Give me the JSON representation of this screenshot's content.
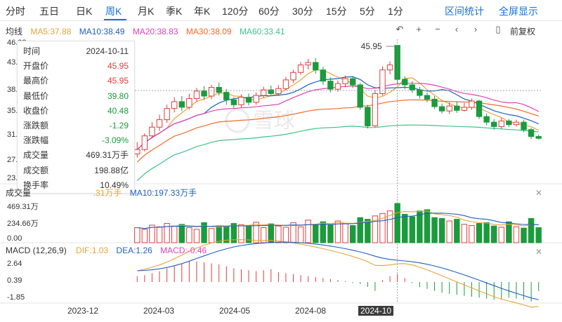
{
  "tabs": [
    {
      "label": "分时",
      "active": false
    },
    {
      "label": "五日",
      "active": false
    },
    {
      "label": "日K",
      "active": false
    },
    {
      "label": "周K",
      "active": true
    },
    {
      "label": "月K",
      "active": false
    },
    {
      "label": "季K",
      "active": false
    },
    {
      "label": "年K",
      "active": false
    },
    {
      "label": "120分",
      "active": false
    },
    {
      "label": "60分",
      "active": false
    },
    {
      "label": "30分",
      "active": false
    },
    {
      "label": "15分",
      "active": false
    },
    {
      "label": "5分",
      "active": false
    },
    {
      "label": "1分",
      "active": false
    }
  ],
  "top_right": {
    "interval_stats": "区间统计",
    "fullscreen": "全屏显示"
  },
  "ma_bar": {
    "label": "均线",
    "ma5": "MA5:37.88",
    "ma10": "MA10:38.49",
    "ma20": "MA20:38.83",
    "ma30": "MA30:38.09",
    "ma60": "MA60:33.41"
  },
  "controls": {
    "rewind_icon": "↶",
    "zoom_in": "+",
    "zoom_out": "−",
    "prev": "‹",
    "next": "›",
    "toggle": "▯",
    "adjust": "前复权"
  },
  "price_axis": [
    "46.93",
    "43.06",
    "38.71",
    "35.31",
    "31.44",
    "27.56",
    "23.69"
  ],
  "peak_label": "45.95",
  "crosshair_price": "38.71",
  "watermark": "雪球",
  "tooltip": {
    "rows": [
      {
        "k": "时间",
        "v": "2024-10-11",
        "color": "#333333"
      },
      {
        "k": "开盘价",
        "v": "45.95",
        "color": "#e03c3c"
      },
      {
        "k": "最高价",
        "v": "45.95",
        "color": "#e03c3c"
      },
      {
        "k": "最低价",
        "v": "39.80",
        "color": "#1a9b3c"
      },
      {
        "k": "收盘价",
        "v": "40.48",
        "color": "#1a9b3c"
      },
      {
        "k": "涨跌额",
        "v": "-1.29",
        "color": "#1a9b3c"
      },
      {
        "k": "涨跌幅",
        "v": "-3.09%",
        "color": "#1a9b3c"
      },
      {
        "k": "成交量",
        "v": "469.31万手",
        "color": "#333333"
      },
      {
        "k": "成交额",
        "v": "198.88亿",
        "color": "#333333"
      },
      {
        "k": "换手率",
        "v": "10.49%",
        "color": "#333333"
      }
    ]
  },
  "volume_panel": {
    "label": "成交量",
    "ma5": ".31万手",
    "ma10": "MA10:197.33万手",
    "axis": [
      "469.31万",
      "234.66万",
      "0.00"
    ]
  },
  "macd_panel": {
    "label": "MACD (12,26,9)",
    "dif": "DIF:1.03",
    "dea": "DEA:1.26",
    "macd": "MACD:-0.46",
    "axis": [
      "2.64",
      "0.39",
      "-1.85"
    ]
  },
  "x_axis": [
    "2023-12",
    "2024-03",
    "2024-05",
    "2024-08",
    "2024-10"
  ],
  "colors": {
    "up": "#e03c3c",
    "down": "#1a9b3c",
    "accent": "#1a6fd6",
    "ma5": "#e8a33a",
    "ma10": "#1f5fbf",
    "ma20": "#e23fb5",
    "ma30": "#f06a2a",
    "ma60": "#3ec28c"
  },
  "chart_data": {
    "type": "candlestick",
    "period": "weekly",
    "price_range": [
      23.69,
      46.93
    ],
    "candles": [
      [
        28.5,
        29.2,
        30.4,
        27.9
      ],
      [
        29.2,
        31.4,
        31.8,
        28.9
      ],
      [
        31.4,
        32.8,
        33.6,
        31.0
      ],
      [
        32.8,
        34.0,
        34.8,
        32.2
      ],
      [
        34.0,
        35.8,
        36.4,
        33.5
      ],
      [
        35.8,
        36.9,
        37.6,
        35.2
      ],
      [
        36.9,
        36.0,
        37.8,
        35.4
      ],
      [
        36.0,
        37.4,
        38.2,
        35.6
      ],
      [
        37.4,
        38.6,
        39.1,
        36.9
      ],
      [
        38.6,
        37.8,
        39.4,
        37.2
      ],
      [
        37.8,
        39.2,
        39.6,
        37.3
      ],
      [
        39.2,
        38.4,
        40.0,
        37.9
      ],
      [
        38.4,
        37.2,
        38.9,
        36.4
      ],
      [
        37.2,
        36.4,
        37.6,
        35.8
      ],
      [
        36.4,
        37.6,
        38.1,
        35.9
      ],
      [
        37.6,
        36.8,
        38.2,
        36.3
      ],
      [
        36.8,
        37.9,
        38.4,
        36.4
      ],
      [
        37.9,
        38.8,
        39.3,
        37.5
      ],
      [
        38.8,
        38.2,
        39.5,
        37.9
      ],
      [
        38.2,
        39.0,
        39.6,
        37.8
      ],
      [
        39.0,
        40.4,
        40.9,
        38.7
      ],
      [
        40.4,
        41.6,
        42.0,
        39.9
      ],
      [
        41.6,
        42.8,
        43.3,
        41.2
      ],
      [
        42.8,
        43.2,
        43.8,
        42.1
      ],
      [
        43.2,
        42.0,
        43.9,
        41.4
      ],
      [
        42.0,
        40.2,
        42.5,
        39.6
      ],
      [
        40.2,
        38.9,
        40.8,
        38.4
      ],
      [
        38.9,
        39.8,
        40.3,
        38.5
      ],
      [
        39.8,
        40.6,
        41.1,
        39.2
      ],
      [
        40.6,
        39.6,
        41.0,
        39.1
      ],
      [
        39.6,
        36.0,
        39.9,
        35.6
      ],
      [
        36.0,
        33.0,
        36.4,
        32.6
      ],
      [
        33.0,
        38.2,
        38.8,
        32.8
      ],
      [
        38.2,
        42.0,
        42.6,
        37.9
      ],
      [
        42.0,
        42.8,
        43.4,
        41.3
      ],
      [
        45.95,
        40.48,
        45.95,
        39.8
      ],
      [
        40.5,
        39.6,
        41.0,
        38.9
      ],
      [
        39.6,
        38.8,
        40.2,
        38.3
      ],
      [
        38.8,
        37.9,
        39.3,
        37.4
      ],
      [
        37.9,
        37.3,
        38.4,
        36.8
      ],
      [
        37.3,
        36.1,
        37.8,
        35.7
      ],
      [
        36.1,
        35.4,
        36.6,
        35.0
      ],
      [
        35.4,
        36.2,
        36.8,
        34.9
      ],
      [
        36.2,
        35.5,
        36.9,
        35.1
      ],
      [
        35.5,
        36.0,
        36.7,
        35.3
      ],
      [
        36.0,
        37.0,
        37.4,
        35.6
      ],
      [
        37.0,
        34.5,
        37.2,
        34.1
      ],
      [
        34.5,
        33.6,
        35.0,
        33.1
      ],
      [
        33.6,
        32.9,
        34.1,
        32.4
      ],
      [
        32.9,
        33.8,
        34.3,
        32.5
      ],
      [
        33.8,
        33.2,
        34.1,
        32.8
      ],
      [
        33.2,
        33.6,
        34.0,
        32.9
      ],
      [
        33.6,
        32.4,
        34.0,
        32.0
      ],
      [
        32.4,
        31.3,
        32.7,
        30.9
      ],
      [
        31.3,
        31.0,
        31.6,
        30.8
      ]
    ],
    "volume_wan_shou": [
      180,
      160,
      210,
      190,
      230,
      200,
      220,
      180,
      160,
      240,
      170,
      200,
      195,
      230,
      215,
      205,
      245,
      180,
      225,
      200,
      185,
      240,
      190,
      270,
      220,
      250,
      210,
      260,
      230,
      205,
      300,
      280,
      320,
      350,
      380,
      469.31,
      340,
      310,
      380,
      395,
      300,
      290,
      260,
      280,
      220,
      205,
      230,
      240,
      200,
      185,
      250,
      190,
      175,
      290,
      180
    ],
    "macd_hist": [
      0.3,
      0.35,
      0.45,
      0.55,
      0.7,
      0.85,
      0.95,
      1.05,
      1.05,
      1.0,
      0.95,
      0.9,
      0.8,
      0.7,
      0.65,
      0.6,
      0.55,
      0.6,
      0.65,
      0.5,
      0.45,
      0.4,
      0.35,
      0.3,
      0.25,
      0.2,
      0.15,
      0.1,
      0.05,
      -0.05,
      -0.1,
      -0.25,
      -0.45,
      0.1,
      0.3,
      0.4,
      0.2,
      -0.05,
      -0.25,
      -0.35,
      -0.45,
      -0.55,
      -0.6,
      -0.65,
      -0.7,
      -0.75,
      -0.8,
      -0.85,
      -0.9,
      -0.88,
      -0.8,
      -0.85,
      -0.9,
      -1.0,
      -0.46
    ]
  }
}
